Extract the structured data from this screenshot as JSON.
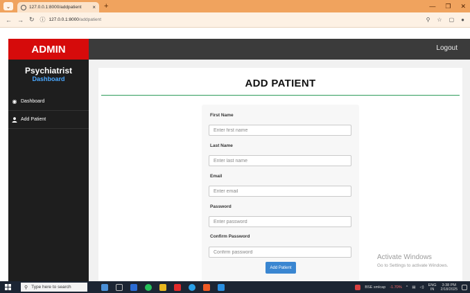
{
  "browser": {
    "tab_title": "127.0.0.1:8000/addpatient",
    "tab_close": "×",
    "new_tab": "+",
    "address_host": "127.0.0.1:8000",
    "address_path": "/addpatient"
  },
  "app": {
    "brand": "ADMIN",
    "logout": "Logout",
    "role_title": "Psychiatrist",
    "role_subtitle": "Dashboard",
    "nav": [
      {
        "label": "Dashboard",
        "icon": "dashboard-icon"
      },
      {
        "label": "Add Patient",
        "icon": "user-icon"
      }
    ]
  },
  "page": {
    "title": "ADD PATIENT"
  },
  "form": {
    "first_name_label": "First Name",
    "first_name_placeholder": "Enter first name",
    "last_name_label": "Last Name",
    "last_name_placeholder": "Enter last name",
    "email_label": "Email",
    "email_placeholder": "Enter email",
    "password_label": "Password",
    "password_placeholder": "Enter password",
    "confirm_label": "Confirm Password",
    "confirm_placeholder": "Confirm password",
    "submit_label": "Add Patient"
  },
  "watermark": {
    "line1": "Activate Windows",
    "line2": "Go to Settings to activate Windows."
  },
  "taskbar": {
    "search_placeholder": "Type here to search",
    "stock_name": "BSE smlcap",
    "stock_change": "-1.70%",
    "lang_top": "ENG",
    "lang_bottom": "IN",
    "time": "3:38 PM",
    "date": "2/18/2025"
  },
  "colors": {
    "brand_red": "#d60b0b",
    "sidebar": "#1e1e1e",
    "accent_blue": "#3a86d1",
    "title_rule_green": "#2c9a5a"
  }
}
